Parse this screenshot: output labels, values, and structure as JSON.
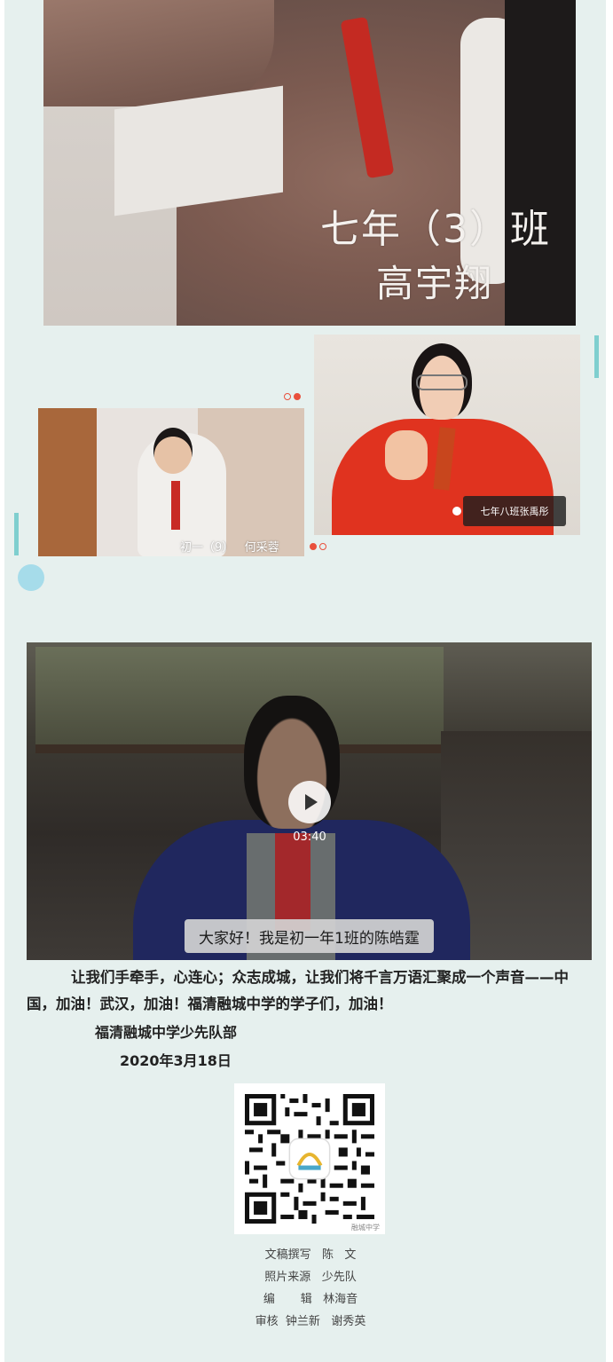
{
  "photos": {
    "top": {
      "caption_class": "七年（3）班",
      "caption_name": "高宇翔"
    },
    "left": {
      "caption": "初一（9）   何采蓉"
    },
    "right": {
      "caption": "七年八班张禹彤"
    }
  },
  "video": {
    "duration": "03:40",
    "subtitle": "大家好！我是初一年1班的陈皓霆"
  },
  "article": {
    "paragraph": "让我们手牵手，心连心；众志成城，让我们将千言万语汇聚成一个声音——中国，加油！武汉，加油！福清融城中学的学子们，加油！",
    "signature": "福清融城中学少先队部",
    "date": "2020年3月18日"
  },
  "qr": {
    "label": "融城中学"
  },
  "credits": [
    "文稿撰写   陈   文",
    "照片来源   少先队",
    "编       辑   林海音",
    "审核  钟兰新   谢秀英"
  ],
  "colors": {
    "background": "#e6f0ee",
    "accent_teal": "#7fcfcf",
    "accent_dot": "#e9503c",
    "circle": "#a6dcea"
  }
}
